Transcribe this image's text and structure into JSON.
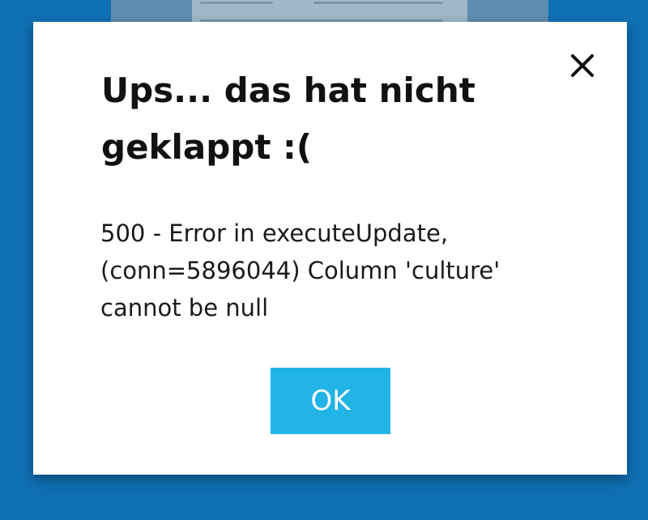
{
  "dialog": {
    "title": "Ups... das hat nicht geklappt :(",
    "message": "500 - Error in executeUpdate, (conn=5896044) Column 'culture' cannot be null",
    "ok_label": "OK",
    "close_icon": "close-icon"
  },
  "colors": {
    "backdrop": "#0f70b4",
    "dialog_background": "#ffffff",
    "ok_button": "#22b4e6",
    "ok_text": "#ffffff",
    "title_text": "#111111"
  }
}
